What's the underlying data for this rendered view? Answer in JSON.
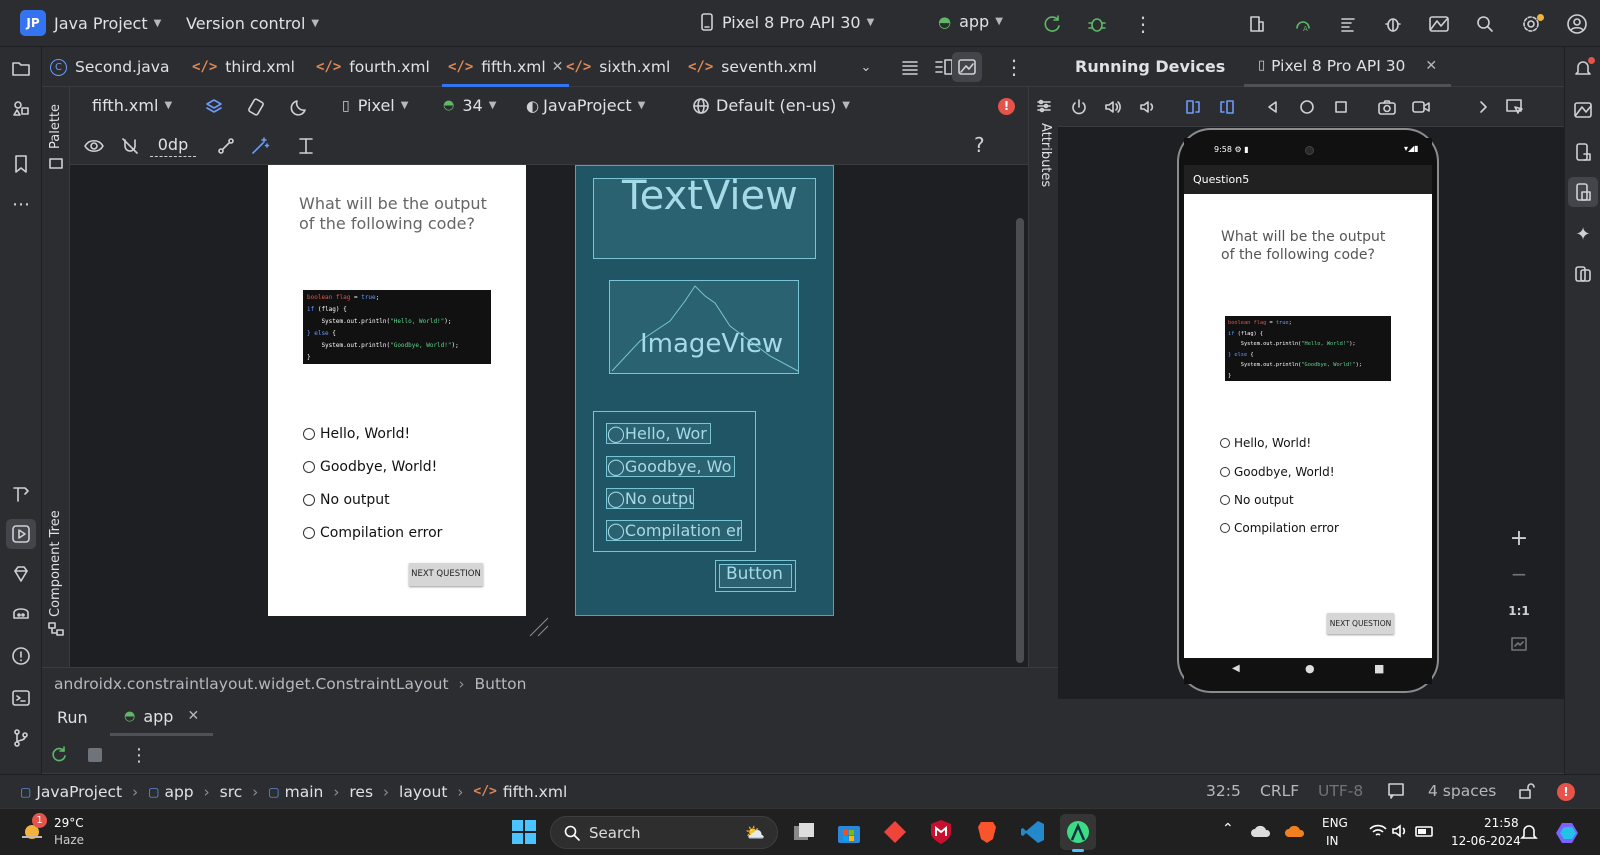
{
  "title_bar": {
    "project_initials": "JP",
    "project_name": "Java Project",
    "vcs_label": "Version control",
    "device_name": "Pixel 8 Pro API 30",
    "run_config": "app"
  },
  "editor_tabs": [
    {
      "label": "Second.java",
      "type": "java"
    },
    {
      "label": "third.xml",
      "type": "xml"
    },
    {
      "label": "fourth.xml",
      "type": "xml"
    },
    {
      "label": "fifth.xml",
      "type": "xml",
      "active": true
    },
    {
      "label": "sixth.xml",
      "type": "xml"
    },
    {
      "label": "seventh.xml",
      "type": "xml"
    }
  ],
  "design_toolbar": {
    "file_select": "fifth.xml",
    "device_select": "Pixel",
    "api_level": "34",
    "theme_select": "JavaProject",
    "locale_select": "Default (en-us)",
    "margin_value": "0dp",
    "help": "?"
  },
  "side_labels": {
    "palette": "Palette",
    "component_tree": "Component Tree",
    "attributes": "Attributes"
  },
  "design_preview": {
    "question": "What will be the output of the following code?",
    "options": [
      "Hello, World!",
      "Goodbye, World!",
      "No output",
      "Compilation error"
    ],
    "next_button": "NEXT QUESTION"
  },
  "code_snippet": [
    "boolean flag = true;",
    "if (flag) {",
    "    System.out.println(\"Hello, World!\");",
    "} else {",
    "    System.out.println(\"Goodbye, World!\");",
    "}"
  ],
  "blueprint": {
    "textview": "TextView",
    "imageview": "ImageView",
    "options": [
      "Hello, Wor",
      "Goodbye, Wo",
      "No outpu",
      "Compilation err"
    ],
    "button": "Button"
  },
  "component_path": {
    "parent": "androidx.constraintlayout.widget.ConstraintLayout",
    "child": "Button"
  },
  "running_devices": {
    "title": "Running Devices",
    "device_tab": "Pixel 8 Pro API 30",
    "status_time": "9:58",
    "app_title": "Question5",
    "zoom_label": "1:1"
  },
  "run_panel": {
    "run_label": "Run",
    "app_tab": "app"
  },
  "breadcrumb": [
    "JavaProject",
    "app",
    "src",
    "main",
    "res",
    "layout",
    "fifth.xml"
  ],
  "status_bar": {
    "position": "32:5",
    "line_sep": "CRLF",
    "encoding": "UTF-8",
    "indent": "4 spaces"
  },
  "taskbar": {
    "weather_temp": "29°C",
    "weather_desc": "Haze",
    "weather_badge": "1",
    "search_placeholder": "Search",
    "lang_line1": "ENG",
    "lang_line2": "IN",
    "clock_time": "21:58",
    "clock_date": "12-06-2024"
  },
  "colors": {
    "accent": "#3574f0",
    "xml_icon": "#e08855",
    "blueprint_bg": "#1f5564",
    "error": "#e5534b"
  }
}
